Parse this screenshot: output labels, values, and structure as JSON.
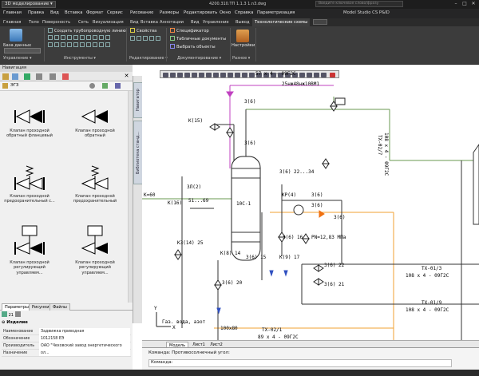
{
  "titlebar": {
    "workspace": "3D моделирование",
    "document": "4200.310.ТП 1.1.3 1.n3.dwg",
    "search_placeholder": "Введите ключевое слово/фразу",
    "btn_min": "–",
    "btn_max": "□",
    "btn_close": "✕"
  },
  "menu": {
    "items": [
      "Главная",
      "Правка",
      "Вид",
      "Вставка",
      "Формат",
      "Сервис",
      "Рисование",
      "Размеры",
      "Редактировать",
      "Окно",
      "Справка",
      "Параметризация"
    ],
    "right": "Model Studio CS P&ID"
  },
  "ribbon_tabs": [
    "Главная",
    "Тело",
    "Поверхность",
    "Сеть",
    "Визуализация",
    "Вид",
    "Вставка",
    "Аннотации",
    "Вид",
    "Управление",
    "Вывод",
    "Технологические схемы"
  ],
  "ribbon": {
    "db_label": "База данных",
    "group_manage": "Управление ▾",
    "inst": [
      "Создать трубопроводную линию",
      "",
      ""
    ],
    "group_tools": "Инструменты ▾",
    "props_btn": "Свойства",
    "group_edit": "Редактирование ▾",
    "spec_btn": "Спецификатор",
    "table_btn": "Табличные документы",
    "select_btn": "Выбрать объекты",
    "group_docs": "Документирование ▾",
    "settings_btn": "Настройки",
    "group_misc": "Разное ▾"
  },
  "nav": {
    "title": "Навигация",
    "path": "ЭГЗ",
    "tiles": [
      "Клапан проходной обратный фланцевый",
      "Клапан проходной обратный",
      "Клапан проходной предохранительный с...",
      "Клапан проходной предохранительный",
      "Клапан проходной регулирующий управляем...",
      "Клапан проходной регулирующий управляем..."
    ]
  },
  "side_tabs": {
    "nav": "Навигатор",
    "lib": "Библиотека станд..."
  },
  "props": {
    "tabs": [
      "Параметры",
      "Рисунки",
      "Файлы"
    ],
    "section": "Изделие",
    "rows": [
      {
        "k": "Наименование",
        "v": "Задвижка приводная"
      },
      {
        "k": "Обозначение",
        "v": "1012158 ЕЭ"
      },
      {
        "k": "Производитель",
        "v": "ОАО \"Чеховский завод энергетического ол..."
      },
      {
        "k": "Назначение",
        "v": ""
      }
    ],
    "zoom": "21"
  },
  "drawing": {
    "labels": {
      "top_pipe": "57 x 4 - 09Г2С",
      "k15": "K(15)",
      "k1b": "K(1b)",
      "pipe_25": "25нж48нж10ВМ1",
      "d6_a": "3(6)",
      "d6_b": "3(6)",
      "d6_22_34": "3(6) 22...34",
      "d3_2": "3Л(2)",
      "k16": "K(16)",
      "k16_val": "51...69",
      "c1": "10С-1",
      "kp4": "KP(4)",
      "d6_c": "3(6)",
      "d6_d": "3(6)",
      "d6_e": "3(6)",
      "d6_f": "3(6)",
      "pn": "PN=12,83 МПа",
      "k60": "K=60",
      "k314": "K3(14) 25",
      "k8": "K(8) 14",
      "d6_15": "3(6) 15",
      "d6_16": "3(6) 16",
      "k9": "K(9) 17",
      "d6_22": "3(6) 22",
      "d6_21": "3(6) 21",
      "d6_20": "3(6) 20",
      "tx13": "ТХ-01/3",
      "tx13_pipe": "108 x 4 - 09Г2С",
      "tx19": "ТХ-01/9",
      "tx19_pipe": "108 x 4 - 09Г2С",
      "tx02_1": "ТХ-02/1",
      "tx02_1_pipe": "89 x 4 - 09Г2С",
      "tx02_7": "ТХ-02/7",
      "tx02_7_pipe": "108 x 4 - 09Г2С",
      "ref_100": "100x80",
      "gas_water": "Газ. вода, азот",
      "x_axis": "X",
      "y_axis": "Y"
    }
  },
  "model_tabs": [
    "Модель",
    "Лист1",
    "Лист2"
  ],
  "command": {
    "line1": "Команда: Противосолнечный угол:",
    "line2": "Команда:"
  },
  "colors": {
    "accent": "#1e6fb5",
    "pipe_orange": "#f0a030",
    "pipe_magenta": "#c040c0",
    "pipe_green": "#6a9a50",
    "pipe_blue": "#3050c0"
  }
}
